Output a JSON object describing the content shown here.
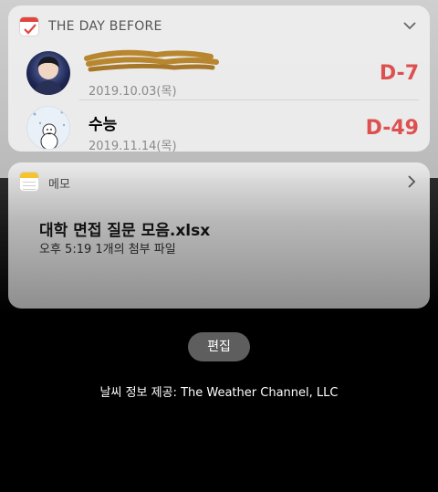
{
  "widget_day_before": {
    "app_name": "THE DAY BEFORE",
    "events": [
      {
        "title": "",
        "date": "2019.10.03(목)",
        "dday": "D-7",
        "title_redacted": true
      },
      {
        "title": "수능",
        "date": "2019.11.14(목)",
        "dday": "D-49"
      }
    ]
  },
  "widget_memo": {
    "app_name": "메모",
    "note_title": "대학 면접 질문 모음.xlsx",
    "note_subtitle": "오후 5:19  1개의 첨부 파일"
  },
  "edit_button_label": "편집",
  "weather_credit": "날씨 정보 제공: The Weather Channel, LLC",
  "colors": {
    "dday_red": "#dd5050",
    "calendar_red": "#e0463e",
    "memo_yellow": "#f5c32c",
    "redaction_brown": "#b8862e"
  }
}
